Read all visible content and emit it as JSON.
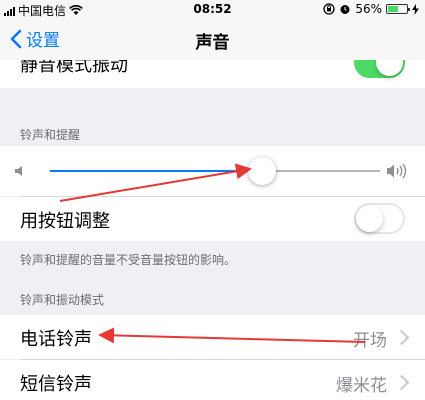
{
  "status_bar": {
    "carrier": "中国电信",
    "time": "08:52",
    "battery_percent": "56%",
    "battery_level": 0.56,
    "icons": [
      "signal-icon",
      "wifi-icon",
      "rotation-lock-icon",
      "alarm-icon",
      "battery-icon",
      "charging-icon"
    ]
  },
  "nav": {
    "back_label": "设置",
    "title": "声音"
  },
  "top_row": {
    "label": "静音模式振动",
    "toggle_on": true
  },
  "ringer_section": {
    "header": "铃声和提醒",
    "volume_level": 0.62,
    "adjust_label": "用按钮调整",
    "adjust_toggle_on": false,
    "footnote": "铃声和提醒的音量不受音量按钮的影响。"
  },
  "patterns_section": {
    "header": "铃声和振动模式",
    "rows": [
      {
        "label": "电话铃声",
        "value": "开场"
      },
      {
        "label": "短信铃声",
        "value": "爆米花"
      }
    ]
  },
  "colors": {
    "accent": "#007aff",
    "toggle_on": "#4cd964",
    "annotation": "#e53935"
  }
}
